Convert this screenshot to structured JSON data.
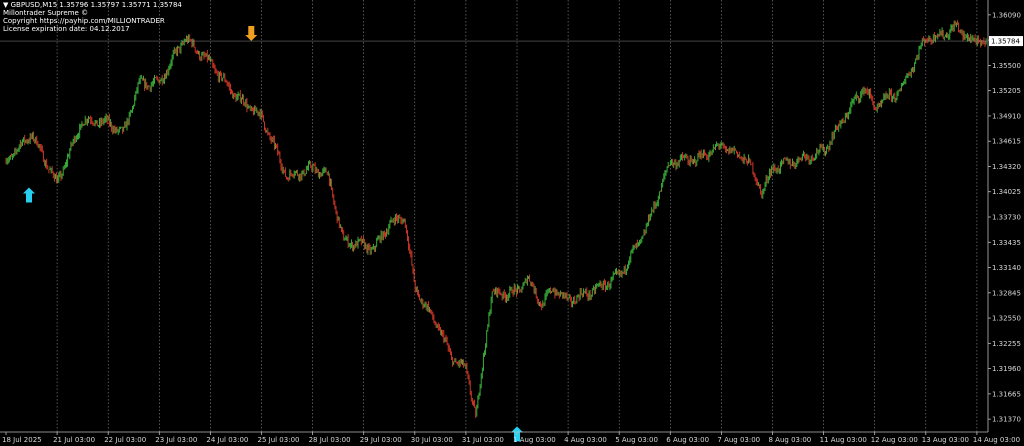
{
  "header": {
    "symbol_line": "▼ GBPUSD,M15  1.35796  1.35797  1.35771  1.35784",
    "indicator_name": "Millontrader Supreme ©",
    "copyright": "Copyright https://payhip.com/MILLIONTRADER",
    "license": "License expiration date: 04.12.2017"
  },
  "colors": {
    "background": "#000000",
    "bull": "#3fbf3f",
    "bear": "#e03a2a",
    "grid": "#8a8a8a",
    "text": "#d8d8d8",
    "buy_arrow": "#27d0f0",
    "sell_arrow": "#f0a020"
  },
  "chart_data": {
    "type": "line",
    "symbol": "GBPUSD",
    "timeframe": "M15",
    "current_price": 1.35784,
    "current_price_label": "1.35784",
    "ylim": [
      1.3122,
      1.3624
    ],
    "y_ticks": [
      "1.36090",
      "1.35795",
      "1.35500",
      "1.35205",
      "1.34910",
      "1.34615",
      "1.34320",
      "1.34025",
      "1.33730",
      "1.33435",
      "1.33140",
      "1.32845",
      "1.32550",
      "1.32255",
      "1.31960",
      "1.31665",
      "1.31370"
    ],
    "x_ticks": [
      "18 Jul 2025",
      "21 Jul 03:00",
      "22 Jul 03:00",
      "23 Jul 03:00",
      "24 Jul 03:00",
      "25 Jul 03:00",
      "28 Jul 03:00",
      "29 Jul 03:00",
      "30 Jul 03:00",
      "31 Jul 03:00",
      "1 Aug 03:00",
      "4 Aug 03:00",
      "5 Aug 03:00",
      "6 Aug 03:00",
      "7 Aug 03:00",
      "8 Aug 03:00",
      "11 Aug 03:00",
      "12 Aug 03:00",
      "13 Aug 03:00",
      "14 Aug 03:00"
    ],
    "x": [
      0.0,
      0.5,
      1.0,
      1.5,
      2.0,
      2.3,
      2.6,
      3.0,
      3.5,
      4.0,
      4.5,
      5.0,
      5.5,
      6.0,
      6.3,
      6.6,
      7.0,
      7.2,
      7.5,
      7.8,
      8.0,
      8.3,
      8.5,
      8.7,
      9.0,
      9.2,
      9.5,
      10.0,
      10.2,
      10.5,
      10.7,
      11.0,
      11.5,
      12.0,
      12.5,
      13.0,
      13.5,
      14.0,
      14.5,
      14.8,
      15.0,
      15.5,
      16.0,
      16.5,
      16.8,
      17.0,
      17.2,
      17.5,
      18.0,
      18.3,
      18.6,
      18.9,
      19.2
    ],
    "values": [
      1.3438,
      1.347,
      1.3412,
      1.3486,
      1.3483,
      1.347,
      1.3528,
      1.353,
      1.3582,
      1.3552,
      1.3514,
      1.349,
      1.342,
      1.343,
      1.3422,
      1.3345,
      1.334,
      1.3335,
      1.3365,
      1.3373,
      1.329,
      1.326,
      1.324,
      1.321,
      1.3195,
      1.314,
      1.3283,
      1.3285,
      1.3302,
      1.327,
      1.329,
      1.3275,
      1.3287,
      1.3304,
      1.3355,
      1.3438,
      1.344,
      1.3456,
      1.344,
      1.3402,
      1.343,
      1.344,
      1.345,
      1.3498,
      1.3525,
      1.35,
      1.351,
      1.352,
      1.3582,
      1.3585,
      1.3595,
      1.3578,
      1.3578
    ],
    "signals": [
      {
        "type": "buy",
        "x": 0.45,
        "price": 1.3397
      },
      {
        "type": "sell",
        "x": 4.8,
        "price": 1.3589
      },
      {
        "type": "buy",
        "x": 10.0,
        "price": 1.3118
      }
    ]
  }
}
